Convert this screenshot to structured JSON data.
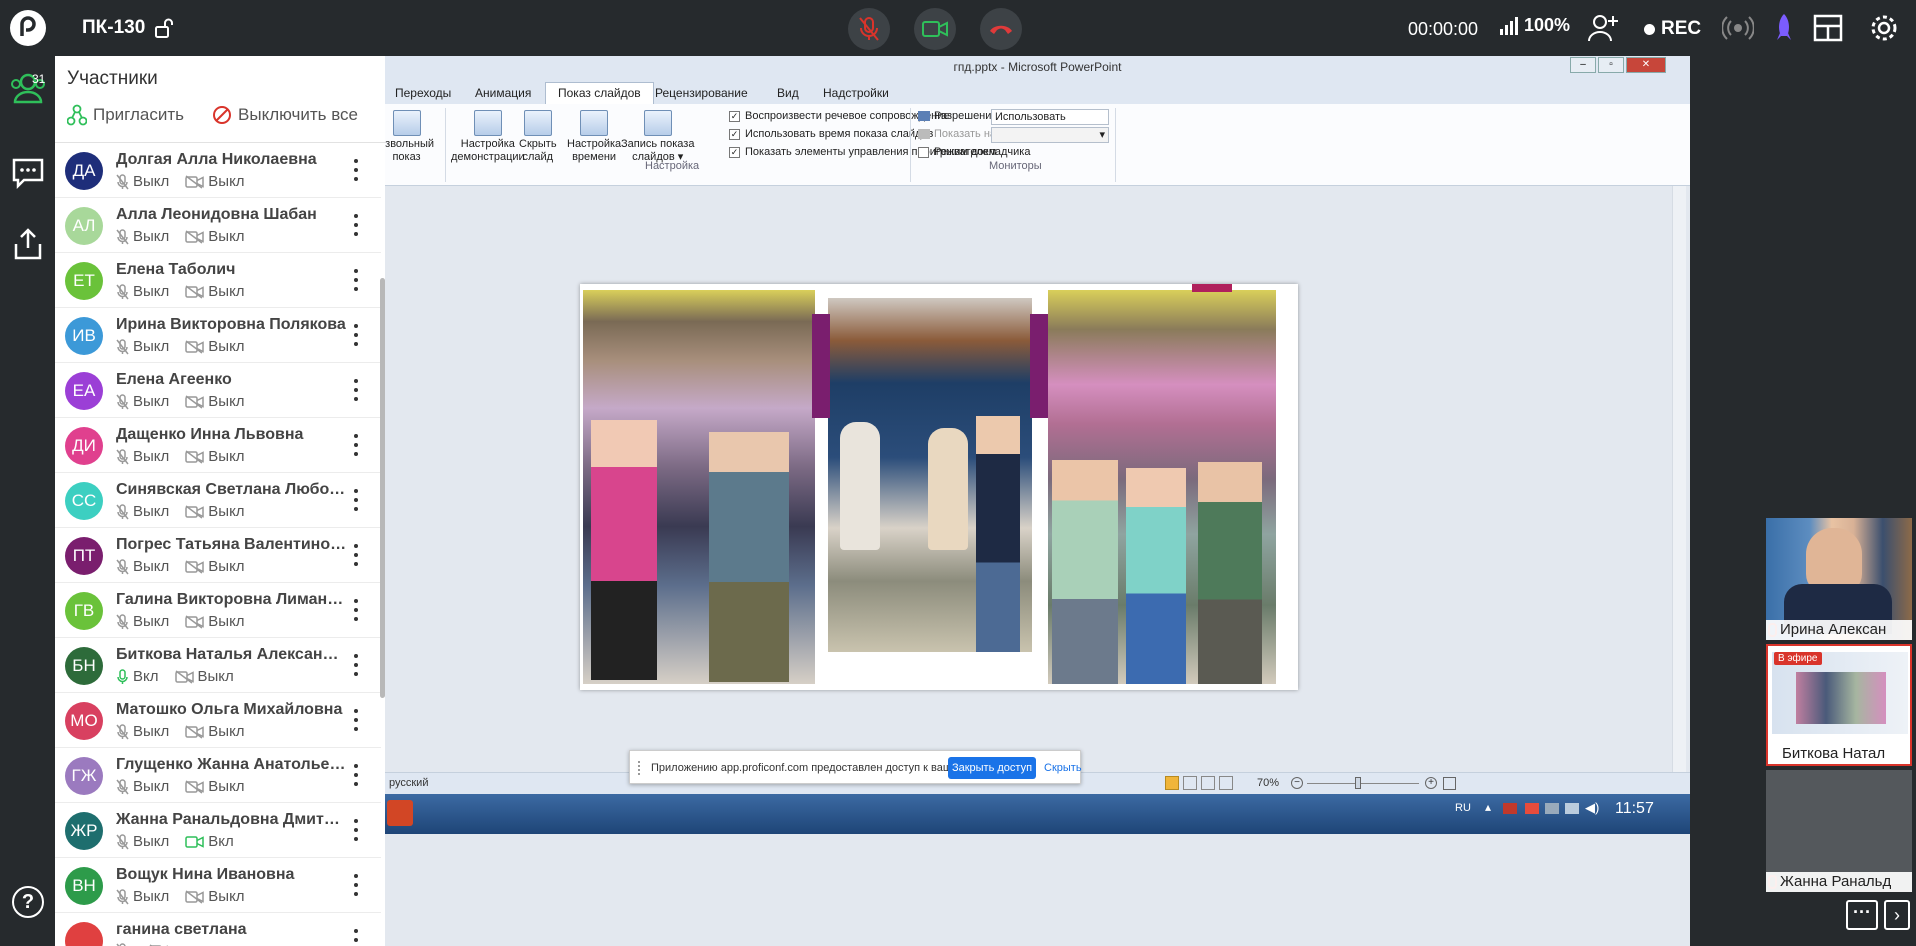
{
  "topbar": {
    "room_name": "ПК-130",
    "timer": "00:00:00",
    "signal": "100%",
    "rec_label": "REC",
    "colors": {
      "mic_off": "#d9342b",
      "camera_on": "#2fbf5a",
      "hangup": "#e03a3a"
    }
  },
  "rail": {
    "participants_count": "31"
  },
  "participants": {
    "title": "Участники",
    "invite_label": "Пригласить",
    "mute_all_label": "Выключить все",
    "items": [
      {
        "initials": "ДА",
        "name": "Долгая Алла Николаевна",
        "mic": "Выкл",
        "cam": "Выкл",
        "color": "#1e2e7a"
      },
      {
        "initials": "АЛ",
        "name": "Алла Леонидовна Шабан",
        "mic": "Выкл",
        "cam": "Выкл",
        "color": "#a8d89a"
      },
      {
        "initials": "ЕТ",
        "name": "Елена Таболич",
        "mic": "Выкл",
        "cam": "Выкл",
        "color": "#6ac23a"
      },
      {
        "initials": "ИВ",
        "name": "Ирина Викторовна Полякова",
        "mic": "Выкл",
        "cam": "Выкл",
        "color": "#3c99d8"
      },
      {
        "initials": "ЕА",
        "name": "Елена Агеенко",
        "mic": "Выкл",
        "cam": "Выкл",
        "color": "#9b3fd6"
      },
      {
        "initials": "ДИ",
        "name": "Дащенко Инна Львовна",
        "mic": "Выкл",
        "cam": "Выкл",
        "color": "#e0408e"
      },
      {
        "initials": "СС",
        "name": "Синявская Светлана Любомировна",
        "mic": "Выкл",
        "cam": "Выкл",
        "color": "#3ccfc1"
      },
      {
        "initials": "ПТ",
        "name": "Погрес Татьяна Валентиновна",
        "mic": "Выкл",
        "cam": "Выкл",
        "color": "#7a1e6e"
      },
      {
        "initials": "ГВ",
        "name": "Галина Викторовна Лимановская",
        "mic": "Выкл",
        "cam": "Выкл",
        "color": "#6ac23a"
      },
      {
        "initials": "БН",
        "name": "Биткова Наталья Александровна",
        "mic": "Вкл",
        "cam": "Выкл",
        "color": "#2d6b3a",
        "mic_on": true
      },
      {
        "initials": "МО",
        "name": "Матошко Ольга Михайловна",
        "mic": "Выкл",
        "cam": "Выкл",
        "color": "#d84060"
      },
      {
        "initials": "ГЖ",
        "name": "Глущенко Жанна Анатольевна",
        "mic": "Выкл",
        "cam": "Выкл",
        "color": "#9b7abf"
      },
      {
        "initials": "ЖР",
        "name": "Жанна Ранальдовна Дмитриева",
        "mic": "Выкл",
        "cam": "Вкл",
        "color": "#1e6e6e",
        "cam_on": true
      },
      {
        "initials": "ВН",
        "name": "Вощук Нина Ивановна",
        "mic": "Выкл",
        "cam": "Выкл",
        "color": "#2d9b4a"
      },
      {
        "initials": "",
        "name": "ганина светлана",
        "mic": "",
        "cam": "",
        "color": "#e04040"
      }
    ]
  },
  "ppt": {
    "window_title": "гпд.pptx - Microsoft PowerPoint",
    "tabs": [
      "Переходы",
      "Анимация",
      "Показ слайдов",
      "Рецензирование",
      "Вид",
      "Надстройки"
    ],
    "ribbon": {
      "btn_custom_1": "извольный",
      "btn_custom_2": "показ",
      "btn_setup_1": "Настройка",
      "btn_setup_2": "демонстрации",
      "btn_hide_1": "Скрыть",
      "btn_hide_2": "слайд",
      "btn_timing_1": "Настройка",
      "btn_timing_2": "времени",
      "btn_record_1": "Запись показа",
      "btn_record_2": "слайдов",
      "chk_narration": "Воспроизвести речевое сопровождение",
      "chk_timings": "Использовать время показа слайдов",
      "chk_controls": "Показать элементы управления проигрывателем",
      "group_setup": "Настройка",
      "resolution_label": "Разрешение:",
      "resolution_value": "Использовать текуще...",
      "show_on_label": "Показать на:",
      "presenter_mode": "Режим докладчика",
      "group_monitors": "Мониторы"
    },
    "status_lang": "русский",
    "zoom": "70%",
    "taskbar_lang": "RU",
    "clock": "11:57"
  },
  "share_notice": {
    "message": "Приложению app.proficonf.com предоставлен доступ к вашему экрану.",
    "stop_label": "Закрыть доступ",
    "hide_label": "Скрыть"
  },
  "tiles": [
    {
      "name": "Ирина Алексан"
    },
    {
      "name": "Биткова Натал",
      "badge": "В эфире"
    },
    {
      "name": "Жанна Ранальд"
    }
  ]
}
